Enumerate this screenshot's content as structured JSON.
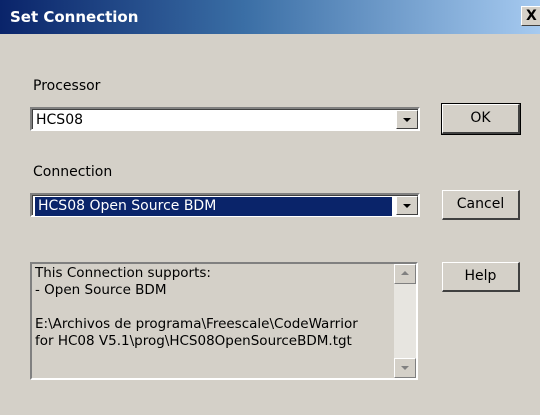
{
  "window": {
    "title": "Set Connection",
    "close_label": "X"
  },
  "processor": {
    "label": "Processor",
    "value": "HCS08"
  },
  "connection": {
    "label": "Connection",
    "value": "HCS08 Open Source BDM"
  },
  "buttons": {
    "ok": "OK",
    "cancel": "Cancel",
    "help": "Help"
  },
  "info": {
    "lines": [
      "This Connection supports:",
      "- Open Source BDM",
      "",
      "E:\\Archivos de programa\\Freescale\\CodeWarrior",
      "for HC08 V5.1\\prog\\HCS08OpenSourceBDM.tgt"
    ]
  },
  "icons": {
    "dropdown": "chevron-down-icon",
    "scroll_up": "scroll-up-icon",
    "scroll_down": "scroll-down-icon"
  },
  "colors": {
    "title_start": "#0a246a",
    "title_end": "#a6caf0",
    "face": "#d4d0c8",
    "selection": "#0a246a"
  }
}
